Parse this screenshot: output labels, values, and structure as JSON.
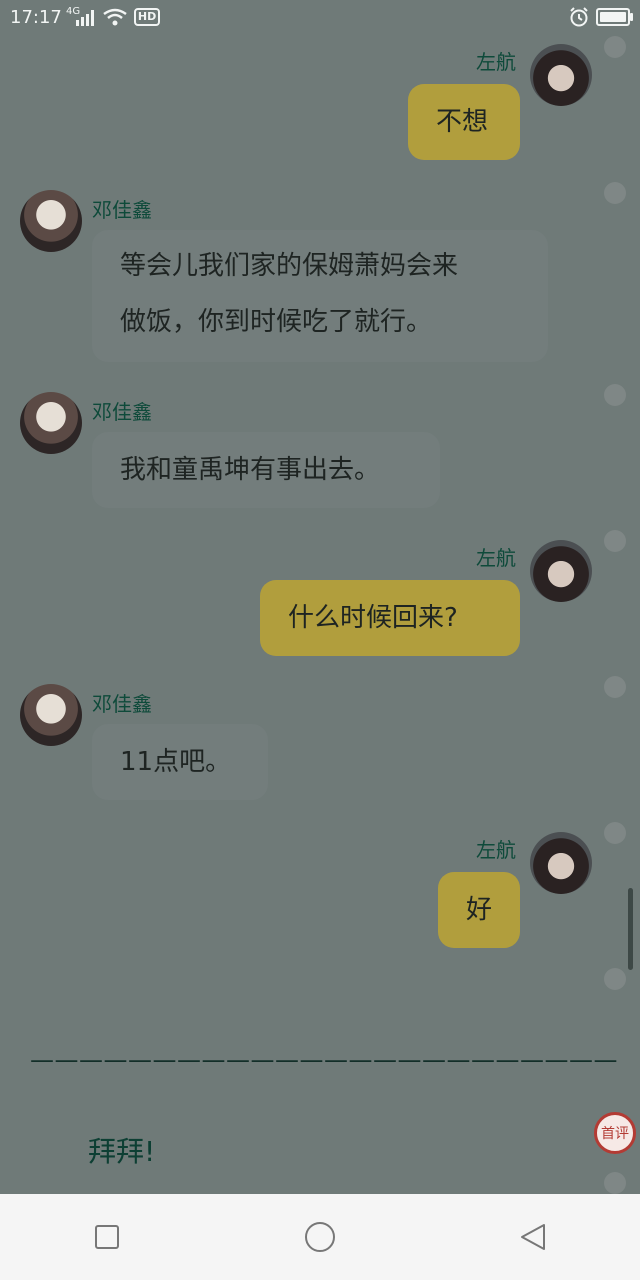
{
  "status_bar": {
    "time": "17:17",
    "network": "4G",
    "hd_label": "HD"
  },
  "messages": [
    {
      "side": "right",
      "sender": "左航",
      "text": "不想"
    },
    {
      "side": "left",
      "sender": "邓佳鑫",
      "text_lines": [
        "等会儿我们家的保姆萧妈会来",
        "做饭，你到时候吃了就行。"
      ]
    },
    {
      "side": "left",
      "sender": "邓佳鑫",
      "text": "我和童禹坤有事出去。"
    },
    {
      "side": "right",
      "sender": "左航",
      "text": "什么时候回来?"
    },
    {
      "side": "left",
      "sender": "邓佳鑫",
      "text": "11点吧。"
    },
    {
      "side": "right",
      "sender": "左航",
      "text": "好"
    }
  ],
  "divider": "————————————————————————",
  "footer_text": "拜拜!",
  "comment_badge": "首评",
  "nav_bar": {
    "square": "square-icon",
    "home": "circle-icon",
    "back": "triangle-back-icon"
  },
  "colors": {
    "background": "#6f7a78",
    "right_bubble": "#b19e3d",
    "left_bubble": "#737d7c",
    "name_text": "#0e4a3a"
  }
}
